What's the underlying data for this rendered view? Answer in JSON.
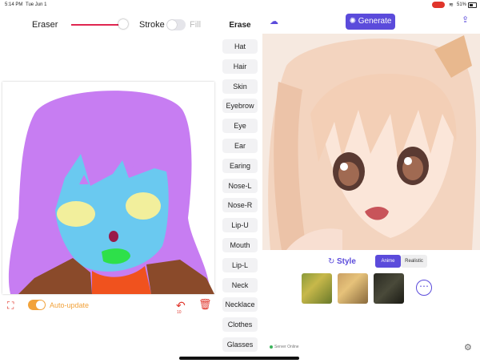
{
  "status_bar": {
    "time": "5:14 PM",
    "date": "Tue Jun 1",
    "battery": "51%"
  },
  "toolbar": {
    "eraser_label": "Eraser",
    "stroke_label": "Stroke",
    "fill_label": "Fill",
    "eraser_size": 0.9,
    "stroke_on": false
  },
  "parts": {
    "title": "Erase",
    "items": [
      "Hat",
      "Hair",
      "Skin",
      "Eyebrow",
      "Eye",
      "Ear",
      "Earing",
      "Nose-L",
      "Nose-R",
      "Lip-U",
      "Mouth",
      "Lip-L",
      "Neck",
      "Necklace",
      "Clothes",
      "Glasses"
    ]
  },
  "bottom_bar": {
    "auto_update_label": "Auto-update",
    "auto_update_on": true,
    "undo_count": "10"
  },
  "header": {
    "generate_label": "Generate"
  },
  "style": {
    "label": "Style",
    "options": [
      "Anime",
      "Realistic"
    ],
    "selected": "Anime"
  },
  "server_status": "Server Online",
  "colors": {
    "accent": "#5b4bdb",
    "danger": "#e0352b",
    "toggle_on": "#f2a23a",
    "hair_mask": "#c77df2",
    "skin_mask": "#6ac9f0",
    "eye_mask": "#f2ef9c",
    "mouth_mask": "#2ee04a",
    "nose_mask": "#9a1a4a",
    "neck_mask": "#f0521e",
    "clothes_mask": "#8a4a2a"
  },
  "icons": {
    "camera": "camera-frame-icon",
    "undo": "undo-icon",
    "trash": "trash-icon",
    "cloud": "cloud-upload-icon",
    "share": "share-icon",
    "generate": "sparkle-icon",
    "more": "more-icon",
    "settings": "gear-icon",
    "style": "refresh-icon"
  }
}
